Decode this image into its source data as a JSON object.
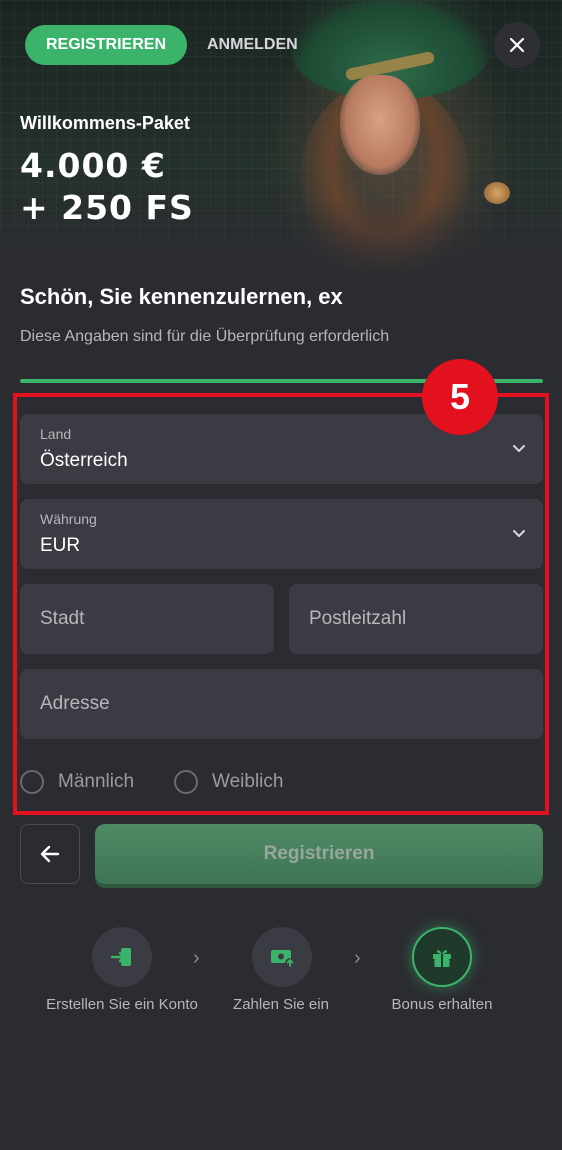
{
  "header": {
    "register_tab": "REGISTRIEREN",
    "login_tab": "ANMELDEN",
    "close_icon": "close-icon"
  },
  "promo": {
    "subtitle": "Willkommens-Paket",
    "line1": "4.000 €",
    "line2": "+ 250 FS"
  },
  "intro": {
    "greeting": "Schön, Sie kennenzulernen, ex",
    "subtitle": "Diese Angaben sind für die Überprüfung erforderlich"
  },
  "annotation": {
    "step_badge": "5"
  },
  "form": {
    "country": {
      "label": "Land",
      "value": "Österreich"
    },
    "currency": {
      "label": "Währung",
      "value": "EUR"
    },
    "city_placeholder": "Stadt",
    "zip_placeholder": "Postleitzahl",
    "address_placeholder": "Adresse",
    "gender": {
      "male": "Männlich",
      "female": "Weiblich"
    },
    "submit_label": "Registrieren"
  },
  "steps": [
    {
      "label": "Erstellen Sie ein Konto",
      "icon": "enter-icon"
    },
    {
      "label": "Zahlen Sie ein",
      "icon": "deposit-icon"
    },
    {
      "label": "Bonus erhalten",
      "icon": "gift-icon"
    }
  ],
  "colors": {
    "accent": "#3bb36a",
    "background": "#2b2c31",
    "field": "#3a3b43",
    "highlight": "#e3101e"
  }
}
